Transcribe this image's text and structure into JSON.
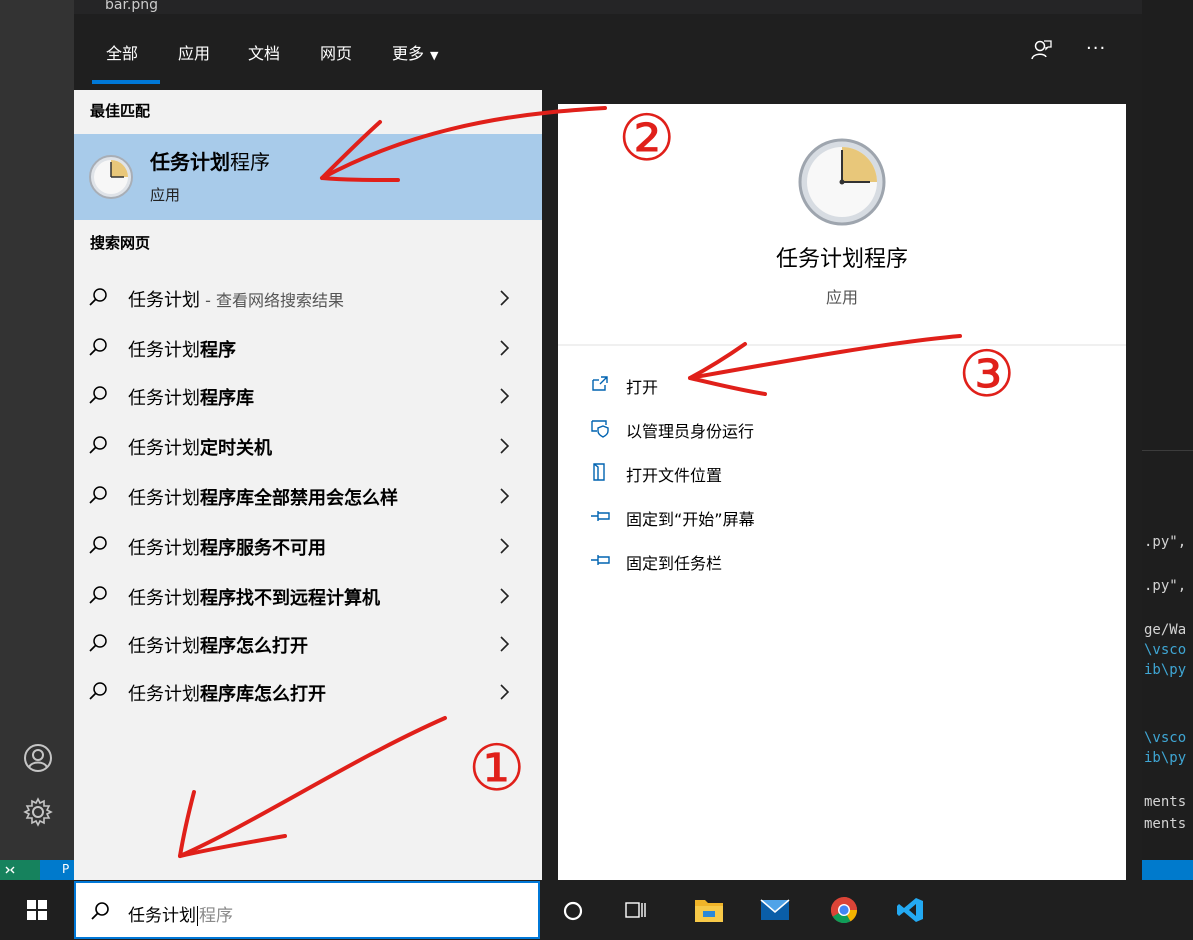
{
  "background": {
    "top_file": "bar.png",
    "code_lines": [
      {
        "text": ".py\",",
        "color": "#d4d4d4"
      },
      {
        "text": ".py\",",
        "color": "#d4d4d4"
      },
      {
        "text": "ge/Wa",
        "color": "#d4d4d4"
      },
      {
        "text": "\\vsco",
        "color": "#3fa6d4"
      },
      {
        "text": "ib\\py",
        "color": "#3fa6d4"
      },
      {
        "text": "\\vsco",
        "color": "#3fa6d4"
      },
      {
        "text": "ib\\py",
        "color": "#3fa6d4"
      },
      {
        "text": "ments",
        "color": "#d4d4d4"
      },
      {
        "text": "ments",
        "color": "#d4d4d4"
      }
    ],
    "status_left": "P"
  },
  "header": {
    "tabs": [
      {
        "label": "全部"
      },
      {
        "label": "应用"
      },
      {
        "label": "文档"
      },
      {
        "label": "网页"
      },
      {
        "label": "更多"
      }
    ],
    "more_icon": "···"
  },
  "left": {
    "best_match_label": "最佳匹配",
    "best_match": {
      "title_bold": "任务计划",
      "title_rest": "程序",
      "subtitle": "应用"
    },
    "web_label": "搜索网页",
    "web_results": [
      {
        "prefix": "任务计划",
        "bold": "",
        "suffix": " - 查看网络搜索结果"
      },
      {
        "prefix": "任务计划",
        "bold": "程序",
        "suffix": ""
      },
      {
        "prefix": "任务计划",
        "bold": "程序库",
        "suffix": ""
      },
      {
        "prefix": "任务计划",
        "bold": "定时关机",
        "suffix": ""
      },
      {
        "prefix": "任务计划",
        "bold": "程序库全部禁用会怎么样",
        "suffix": ""
      },
      {
        "prefix": "任务计划",
        "bold": "程序服务不可用",
        "suffix": ""
      },
      {
        "prefix": "任务计划",
        "bold": "程序找不到远程计算机",
        "suffix": ""
      },
      {
        "prefix": "任务计划",
        "bold": "程序怎么打开",
        "suffix": ""
      },
      {
        "prefix": "任务计划",
        "bold": "程序库怎么打开",
        "suffix": ""
      }
    ]
  },
  "detail": {
    "title": "任务计划程序",
    "subtitle": "应用",
    "actions": [
      {
        "label": "打开",
        "icon": "open-icon"
      },
      {
        "label": "以管理员身份运行",
        "icon": "run-as-admin-icon"
      },
      {
        "label": "打开文件位置",
        "icon": "file-location-icon"
      },
      {
        "label": "固定到“开始”屏幕",
        "icon": "pin-icon"
      },
      {
        "label": "固定到任务栏",
        "icon": "pin-icon"
      }
    ]
  },
  "search": {
    "typed": "任务计划",
    "suggestion": "程序"
  },
  "annotations": {
    "one": "①",
    "two": "②",
    "three": "③",
    "color": "#e0201a"
  }
}
